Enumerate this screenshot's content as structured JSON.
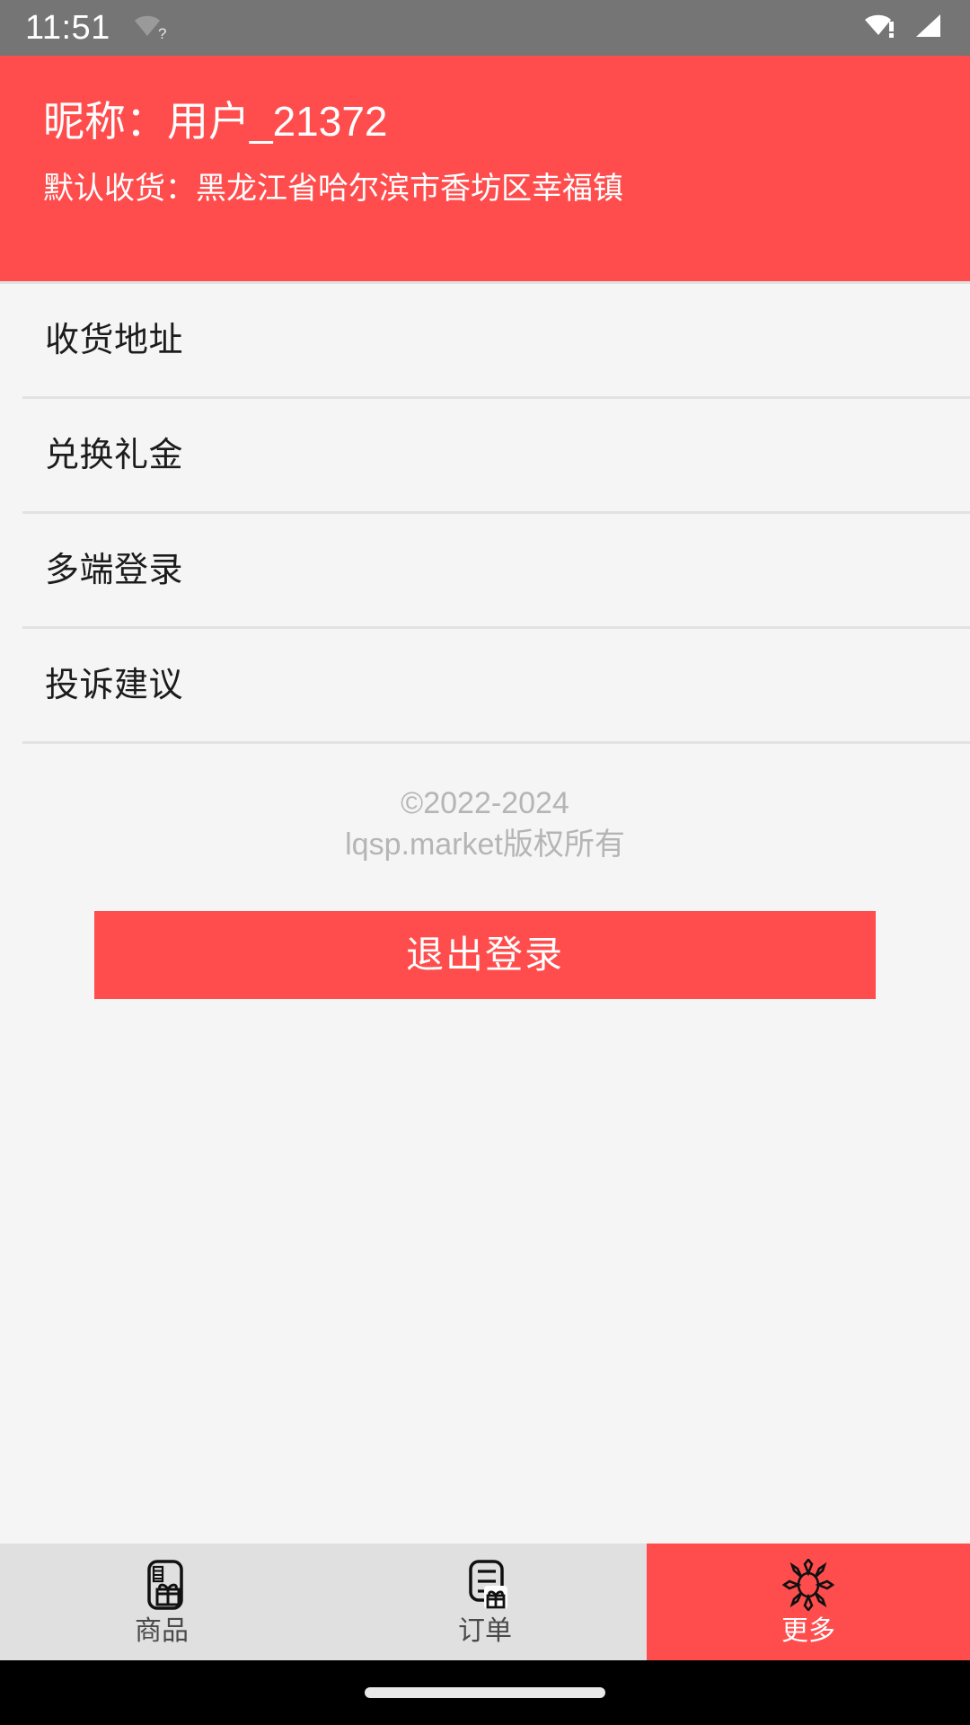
{
  "status_bar": {
    "time": "11:51",
    "wifi_unknown_icon": "wifi-question-icon",
    "wifi_alert_icon": "wifi-alert-icon",
    "signal_icon": "cellular-signal-icon"
  },
  "header": {
    "nickname": "昵称：用户_21372",
    "default_address": "默认收货：黑龙江省哈尔滨市香坊区幸福镇",
    "background_color": "#ff4d4d",
    "text_color": "#ffffff"
  },
  "menu": {
    "items": [
      {
        "label": "收货地址",
        "name": "shipping-address"
      },
      {
        "label": "兑换礼金",
        "name": "redeem-gift"
      },
      {
        "label": "多端登录",
        "name": "multi-device-login"
      },
      {
        "label": "投诉建议",
        "name": "complaint-suggestion"
      }
    ]
  },
  "copyright": {
    "line1": "©2022-2024",
    "line2": "lqsp.market版权所有"
  },
  "logout": {
    "label": "退出登录",
    "background_color": "#ff4d4d"
  },
  "tabbar": {
    "active_color": "#ff4d4d",
    "inactive_color": "#e0e0e0",
    "tabs": [
      {
        "label": "商品",
        "icon": "gift-card-icon",
        "active": false
      },
      {
        "label": "订单",
        "icon": "order-list-gift-icon",
        "active": false
      },
      {
        "label": "更多",
        "icon": "sun-burst-icon",
        "active": true
      }
    ]
  }
}
